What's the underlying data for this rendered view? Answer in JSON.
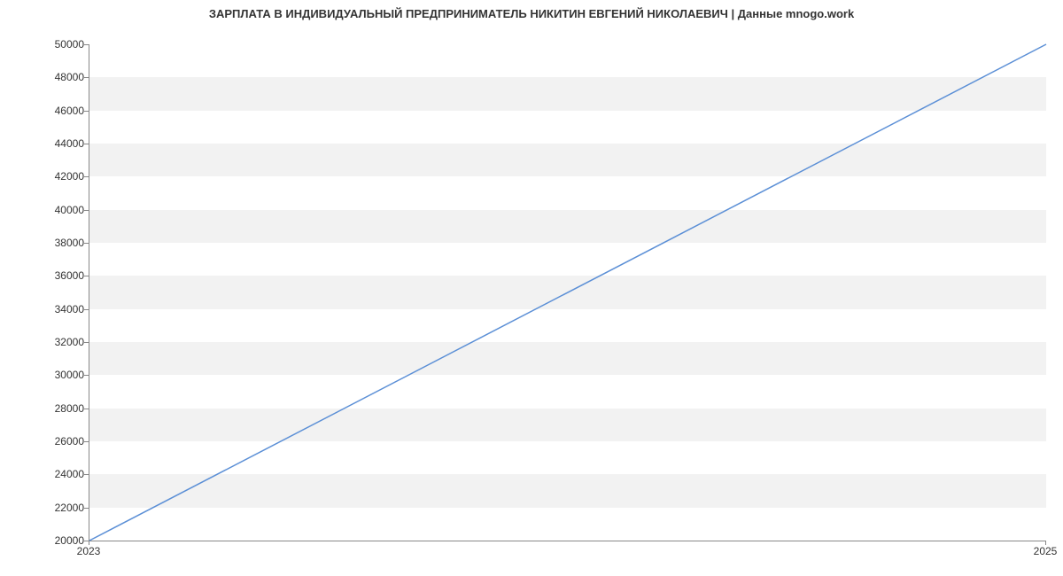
{
  "chart_data": {
    "type": "line",
    "title": "ЗАРПЛАТА В ИНДИВИДУАЛЬНЫЙ ПРЕДПРИНИМАТЕЛЬ НИКИТИН ЕВГЕНИЙ НИКОЛАЕВИЧ | Данные mnogo.work",
    "xlabel": "",
    "ylabel": "",
    "x": [
      2023,
      2025
    ],
    "values": [
      20000,
      50000
    ],
    "x_ticks": [
      2023,
      2025
    ],
    "y_ticks": [
      20000,
      22000,
      24000,
      26000,
      28000,
      30000,
      32000,
      34000,
      36000,
      38000,
      40000,
      42000,
      44000,
      46000,
      48000,
      50000
    ],
    "xlim": [
      2023,
      2025
    ],
    "ylim": [
      20000,
      50000
    ],
    "line_color": "#5b8fd6",
    "grid_band_color": "#f2f2f2"
  }
}
